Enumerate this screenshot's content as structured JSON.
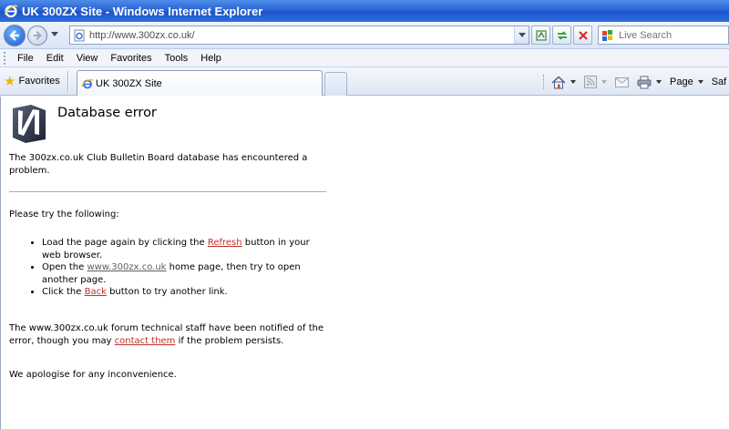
{
  "window": {
    "title": "UK 300ZX Site - Windows Internet Explorer"
  },
  "address": {
    "url": "http://www.300zx.co.uk/"
  },
  "search": {
    "placeholder": "Live Search"
  },
  "menu": {
    "items": [
      "File",
      "Edit",
      "View",
      "Favorites",
      "Tools",
      "Help"
    ]
  },
  "favorites": {
    "label": "Favorites"
  },
  "tab": {
    "title": "UK 300ZX Site"
  },
  "commandbar": {
    "page_label": "Page",
    "safety_label": "Saf"
  },
  "page": {
    "heading": "Database error",
    "intro": "The 300zx.co.uk Club Bulletin Board database has encountered a problem.",
    "try_heading": "Please try the following:",
    "item1": {
      "before": "Load the page again by clicking the ",
      "link": "Refresh",
      "after": " button in your web browser."
    },
    "item2": {
      "before": "Open the ",
      "link": "www.300zx.co.uk",
      "after": " home page, then try to open another page."
    },
    "item3": {
      "before": "Click the ",
      "link": "Back",
      "after": " button to try another link."
    },
    "notice": {
      "before": "The www.300zx.co.uk forum technical staff have been notified of the error, though you may ",
      "link": "contact them",
      "after": " if the problem persists."
    },
    "apology": "We apologise for any inconvenience."
  },
  "colors": {
    "link": "#c0302a",
    "titlebar": "#2a64d6"
  }
}
